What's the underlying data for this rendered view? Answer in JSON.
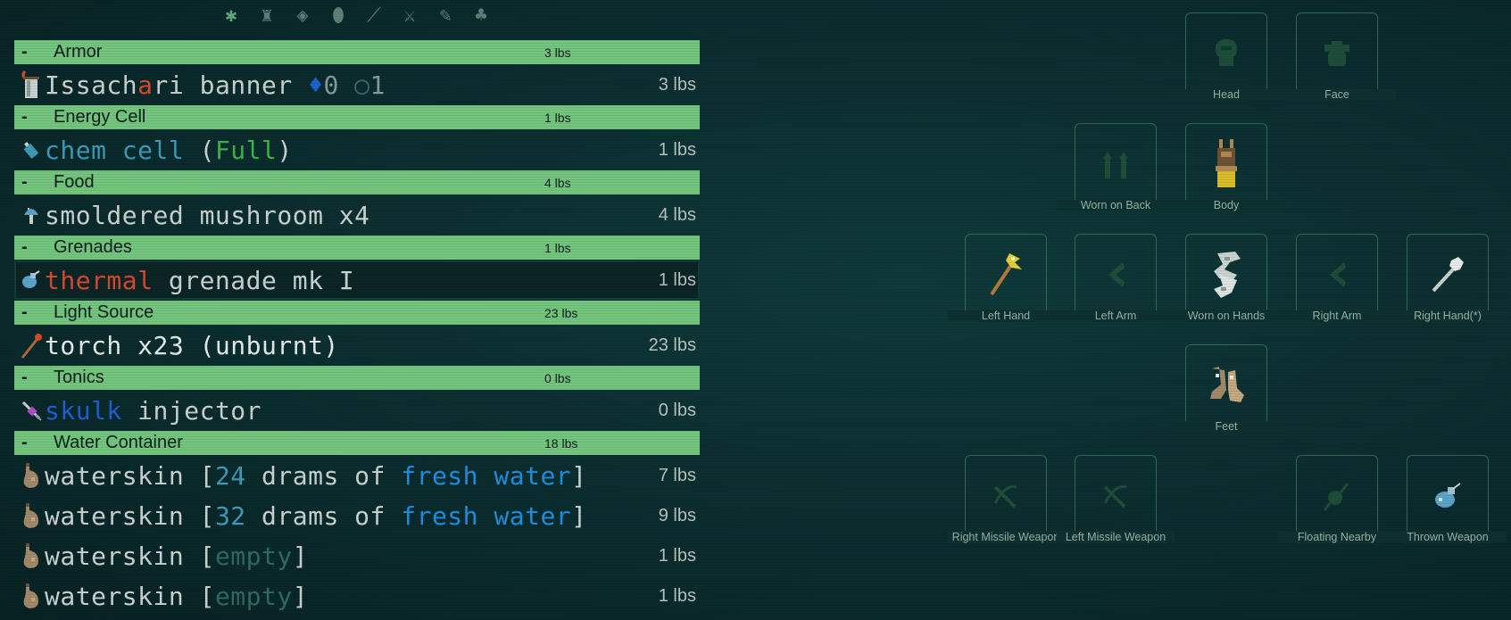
{
  "filters": [
    {
      "icon": "asterisk-all-icon",
      "glyph": "✱",
      "active": true
    },
    {
      "icon": "mannequin-icon",
      "glyph": "♜",
      "active": false
    },
    {
      "icon": "armor-icon",
      "glyph": "◈",
      "active": false
    },
    {
      "icon": "cell-icon",
      "glyph": "⬮",
      "active": false
    },
    {
      "icon": "gun-icon",
      "glyph": "⟋",
      "active": false
    },
    {
      "icon": "sword-icon",
      "glyph": "⚔",
      "active": false
    },
    {
      "icon": "syringe-icon",
      "glyph": "✎",
      "active": false
    },
    {
      "icon": "tree-icon",
      "glyph": "♣",
      "active": false
    }
  ],
  "categories": [
    {
      "name": "Armor",
      "weight": "3 lbs",
      "items": [
        {
          "icon": "banner-icon",
          "parts": [
            {
              "t": "Issach",
              "c": "#c9d3cf"
            },
            {
              "t": "a",
              "c": "#d84a2b"
            },
            {
              "t": "ri banner ",
              "c": "#c9d3cf"
            },
            {
              "t": "♦",
              "c": "#1f5fd0"
            },
            {
              "t": "0 ",
              "c": "#8899a0"
            },
            {
              "t": "○",
              "c": "#3d7070"
            },
            {
              "t": "1",
              "c": "#8899a0"
            }
          ],
          "weight": "3 lbs"
        }
      ]
    },
    {
      "name": "Energy Cell",
      "weight": "1 lbs",
      "items": [
        {
          "icon": "chem-cell-icon",
          "parts": [
            {
              "t": "chem cell ",
              "c": "#3d9bb8"
            },
            {
              "t": "(",
              "c": "#c9d3cf"
            },
            {
              "t": "Full",
              "c": "#3fb34a"
            },
            {
              "t": ")",
              "c": "#c9d3cf"
            }
          ],
          "weight": "1 lbs"
        }
      ]
    },
    {
      "name": "Food",
      "weight": "4 lbs",
      "items": [
        {
          "icon": "mushroom-icon",
          "parts": [
            {
              "t": "smoldered mushroom x4",
              "c": "#c9d3cf"
            }
          ],
          "weight": "4 lbs"
        }
      ]
    },
    {
      "name": "Grenades",
      "weight": "1 lbs",
      "items": [
        {
          "icon": "grenade-icon",
          "parts": [
            {
              "t": "thermal ",
              "c": "#d84a2b"
            },
            {
              "t": "grenade mk I",
              "c": "#c9d3cf"
            }
          ],
          "weight": "1 lbs",
          "selected": true
        }
      ]
    },
    {
      "name": "Light Source",
      "weight": "23 lbs",
      "items": [
        {
          "icon": "torch-icon",
          "parts": [
            {
              "t": "torch x23 (unburnt)",
              "c": "#e6ece9"
            }
          ],
          "weight": "23 lbs"
        }
      ]
    },
    {
      "name": "Tonics",
      "weight": "0 lbs",
      "items": [
        {
          "icon": "injector-icon",
          "parts": [
            {
              "t": "skulk ",
              "c": "#1f5fd0"
            },
            {
              "t": "injector",
              "c": "#c9d3cf"
            }
          ],
          "weight": "0 lbs"
        }
      ]
    },
    {
      "name": "Water Container",
      "weight": "18 lbs",
      "items": [
        {
          "icon": "waterskin-icon",
          "parts": [
            {
              "t": "waterskin [",
              "c": "#c9d3cf"
            },
            {
              "t": "24",
              "c": "#3d9bb8"
            },
            {
              "t": " drams of ",
              "c": "#c9d3cf"
            },
            {
              "t": "fresh water",
              "c": "#1e8fe0"
            },
            {
              "t": "]",
              "c": "#c9d3cf"
            }
          ],
          "weight": "7 lbs"
        },
        {
          "icon": "waterskin-icon",
          "parts": [
            {
              "t": "waterskin [",
              "c": "#c9d3cf"
            },
            {
              "t": "32",
              "c": "#3d9bb8"
            },
            {
              "t": " drams of ",
              "c": "#c9d3cf"
            },
            {
              "t": "fresh water",
              "c": "#1e8fe0"
            },
            {
              "t": "]",
              "c": "#c9d3cf"
            }
          ],
          "weight": "9 lbs"
        },
        {
          "icon": "waterskin-icon",
          "parts": [
            {
              "t": "waterskin [",
              "c": "#c9d3cf"
            },
            {
              "t": "empty",
              "c": "#2f6a62"
            },
            {
              "t": "]",
              "c": "#c9d3cf"
            }
          ],
          "weight": "1 lbs"
        },
        {
          "icon": "waterskin-icon",
          "parts": [
            {
              "t": "waterskin [",
              "c": "#c9d3cf"
            },
            {
              "t": "empty",
              "c": "#2f6a62"
            },
            {
              "t": "]",
              "c": "#c9d3cf"
            }
          ],
          "weight": "1 lbs"
        }
      ]
    }
  ],
  "slots": {
    "head": {
      "label": "Head",
      "icon": "head-silhouette-icon",
      "equipped": false
    },
    "face": {
      "label": "Face",
      "icon": "face-silhouette-icon",
      "equipped": false
    },
    "back": {
      "label": "Worn on Back",
      "icon": "back-silhouette-icon",
      "equipped": false
    },
    "body": {
      "label": "Body",
      "icon": "leather-apron-icon",
      "equipped": true
    },
    "left_hand": {
      "label": "Left Hand",
      "icon": "golden-staff-icon",
      "equipped": true
    },
    "left_arm": {
      "label": "Left Arm",
      "icon": "arm-silhouette-icon",
      "equipped": false
    },
    "hands": {
      "label": "Worn on Hands",
      "icon": "gauntlets-icon",
      "equipped": true
    },
    "right_arm": {
      "label": "Right Arm",
      "icon": "arm-silhouette-icon",
      "equipped": false
    },
    "right_hand": {
      "label": "Right Hand(*)",
      "icon": "hammer-icon",
      "equipped": true
    },
    "feet": {
      "label": "Feet",
      "icon": "boots-icon",
      "equipped": true
    },
    "right_missile": {
      "label": "Right Missile Weapon",
      "icon": "crossbow-silhouette-icon",
      "equipped": false
    },
    "left_missile": {
      "label": "Left Missile Weapon",
      "icon": "crossbow-silhouette-icon",
      "equipped": false
    },
    "floating": {
      "label": "Floating Nearby",
      "icon": "orb-silhouette-icon",
      "equipped": false
    },
    "thrown": {
      "label": "Thrown Weapon",
      "icon": "grenade-icon",
      "equipped": true
    }
  }
}
